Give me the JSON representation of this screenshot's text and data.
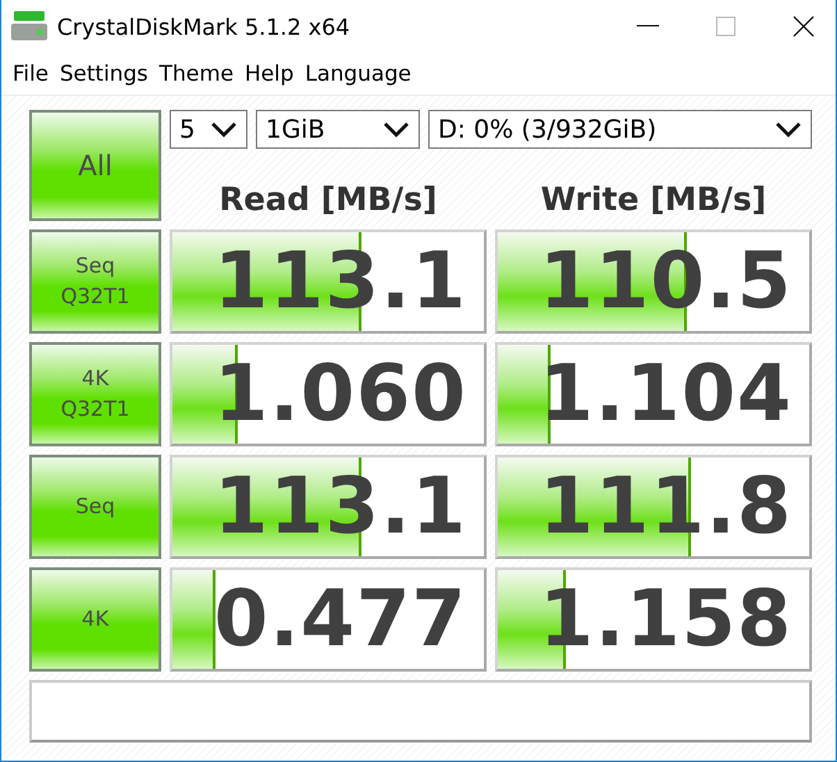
{
  "window": {
    "title": "CrystalDiskMark 5.1.2 x64"
  },
  "menu": [
    "File",
    "Settings",
    "Theme",
    "Help",
    "Language"
  ],
  "all_button": "All",
  "selectors": {
    "count": "5",
    "size": "1GiB",
    "drive": "D: 0% (3/932GiB)"
  },
  "columns": [
    "Read [MB/s]",
    "Write [MB/s]"
  ],
  "rows": [
    {
      "test": "Seq\nQ32T1",
      "read": {
        "value": "113.1",
        "level": 0.6
      },
      "write": {
        "value": "110.5",
        "level": 0.6
      }
    },
    {
      "test": "4K\nQ32T1",
      "read": {
        "value": "1.060",
        "level": 0.2
      },
      "write": {
        "value": "1.104",
        "level": 0.16
      }
    },
    {
      "test": "Seq",
      "read": {
        "value": "113.1",
        "level": 0.6
      },
      "write": {
        "value": "111.8",
        "level": 0.61
      }
    },
    {
      "test": "4K",
      "read": {
        "value": "0.477",
        "level": 0.13
      },
      "write": {
        "value": "1.158",
        "level": 0.21
      }
    }
  ]
}
